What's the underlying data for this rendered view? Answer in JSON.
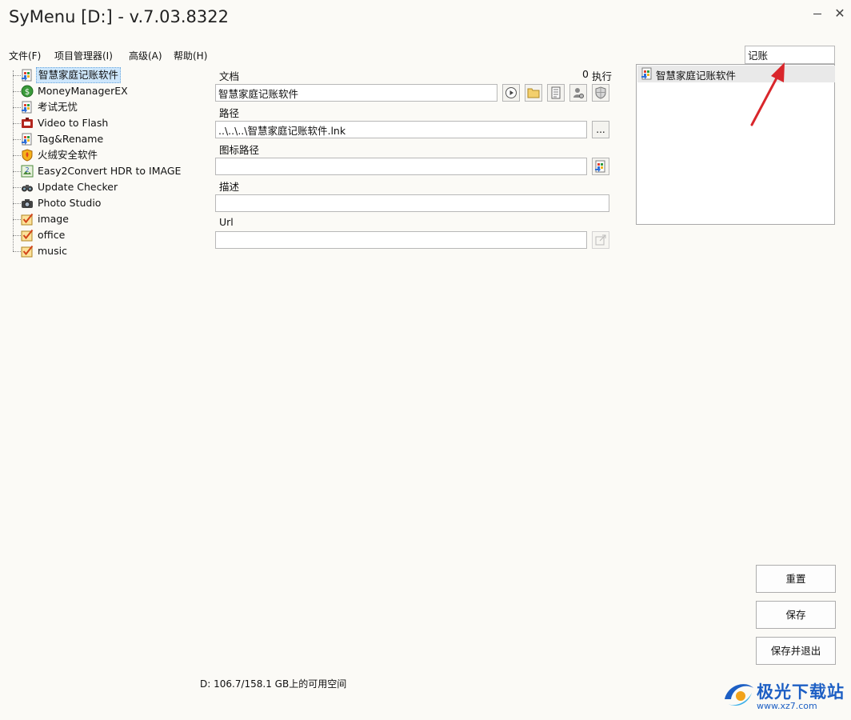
{
  "window": {
    "title": "SyMenu [D:] - v.7.03.8322"
  },
  "menu": [
    {
      "label": "文件(F)"
    },
    {
      "label": "项目管理器(I)"
    },
    {
      "label": "高级(A)"
    },
    {
      "label": "帮助(H)"
    }
  ],
  "tree": [
    {
      "label": "智慧家庭记账软件",
      "icon": "app-icon",
      "selected": true
    },
    {
      "label": "MoneyManagerEX",
      "icon": "money-icon"
    },
    {
      "label": "考试无忧",
      "icon": "app-icon"
    },
    {
      "label": "Video to Flash",
      "icon": "video-icon"
    },
    {
      "label": "Tag&Rename",
      "icon": "app-icon"
    },
    {
      "label": "火绒安全软件",
      "icon": "shield-icon"
    },
    {
      "label": "Easy2Convert HDR to IMAGE",
      "icon": "image-convert-icon"
    },
    {
      "label": "Update Checker",
      "icon": "binoculars-icon"
    },
    {
      "label": "Photo Studio",
      "icon": "camera-icon"
    },
    {
      "label": "image",
      "icon": "folder-check-icon"
    },
    {
      "label": "office",
      "icon": "folder-check-icon"
    },
    {
      "label": "music",
      "icon": "folder-check-icon"
    }
  ],
  "form": {
    "document_label": "文档",
    "exec_count": "0",
    "exec_label": "执行",
    "document_value": "智慧家庭记账软件",
    "path_label": "路径",
    "path_value": "..\\..\\..\\智慧家庭记账软件.lnk",
    "browse_label": "...",
    "icon_path_label": "图标路径",
    "icon_path_value": "",
    "description_label": "描述",
    "description_value": "",
    "url_label": "Url",
    "url_value": ""
  },
  "search": {
    "value": "记账",
    "results": [
      {
        "label": "智慧家庭记账软件"
      }
    ]
  },
  "buttons": {
    "reset": "重置",
    "save": "保存",
    "save_exit": "保存并退出"
  },
  "status": {
    "disk_space": "D: 106.7/158.1 GB上的可用空间"
  },
  "watermark": {
    "brand": "极光下载站",
    "url": "www.xz7.com"
  },
  "colors": {
    "selection": "#cde6fb",
    "annotation_arrow": "#d9262b",
    "watermark": "#1d5fc4"
  }
}
